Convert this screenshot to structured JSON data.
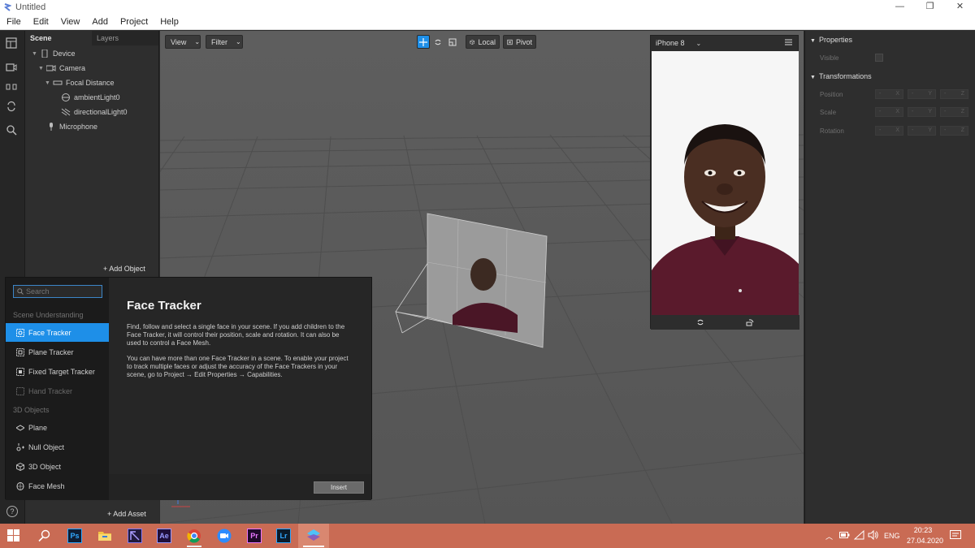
{
  "window": {
    "title": "Untitled",
    "minimize": "—",
    "restore": "❐",
    "close": "✕"
  },
  "menu": [
    "File",
    "Edit",
    "View",
    "Add",
    "Project",
    "Help"
  ],
  "scene_panel": {
    "tabs": [
      "Scene",
      "Layers"
    ],
    "tree": [
      {
        "label": "Device",
        "icon": "phone-icon"
      },
      {
        "label": "Camera",
        "icon": "camera-icon"
      },
      {
        "label": "Focal Distance",
        "icon": "focal-distance-icon"
      },
      {
        "label": "ambientLight0",
        "icon": "ambient-light-icon"
      },
      {
        "label": "directionalLight0",
        "icon": "directional-light-icon"
      },
      {
        "label": "Microphone",
        "icon": "microphone-icon"
      }
    ],
    "add_object": "+ Add Object"
  },
  "assets": {
    "add_asset": "+ Add Asset"
  },
  "viewport": {
    "view_label": "View",
    "filter_label": "Filter",
    "local_label": "Local",
    "pivot_label": "Pivot"
  },
  "simulator": {
    "device": "iPhone 8"
  },
  "properties": {
    "properties_label": "Properties",
    "visible_label": "Visible",
    "transformations_label": "Transformations",
    "position_label": "Position",
    "scale_label": "Scale",
    "rotation_label": "Rotation",
    "dash": "-",
    "axis_x": "X",
    "axis_y": "Y",
    "axis_z": "Z"
  },
  "insert_dialog": {
    "search_placeholder": "Search",
    "categories": {
      "scene_understanding": "Scene Understanding",
      "objects_3d": "3D Objects"
    },
    "items": {
      "face_tracker": "Face Tracker",
      "plane_tracker": "Plane Tracker",
      "fixed_target_tracker": "Fixed Target Tracker",
      "hand_tracker": "Hand Tracker",
      "plane": "Plane",
      "null_object": "Null Object",
      "object_3d": "3D Object",
      "face_mesh": "Face Mesh"
    },
    "title": "Face Tracker",
    "description_1": "Find, follow and select a single face in your scene. If you add children to the Face Tracker, it will control their position, scale and rotation. It can also be used to control a Face Mesh.",
    "description_2": "You can have more than one Face Tracker in a scene. To enable your project to track multiple faces or adjust the accuracy of the Face Trackers in your scene, go to Project → Edit Properties → Capabilities.",
    "insert_label": "Insert"
  },
  "taskbar": {
    "apps": [
      "start-icon",
      "search-icon",
      "photoshop-icon",
      "file-explorer-icon",
      "premiere-rush-icon",
      "after-effects-icon",
      "chrome-icon",
      "zoom-icon",
      "premiere-pro-icon",
      "lightroom-icon",
      "spark-ar-icon"
    ],
    "ps": "Ps",
    "ae": "Ae",
    "pr": "Pr",
    "lr": "Lr",
    "language": "ENG",
    "time": "20:23",
    "date": "27.04.2020"
  },
  "colors": {
    "accent": "#1e8fe8",
    "taskbar": "#c96b54",
    "viewport": "#595959"
  }
}
